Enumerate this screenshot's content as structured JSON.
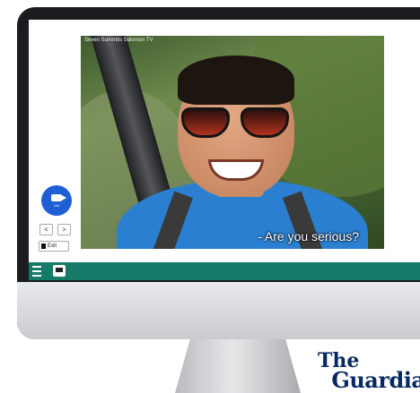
{
  "video": {
    "credit": "Seven Summits Salomon TV",
    "subtitle": "- Are you serious?"
  },
  "controls": {
    "call_label": "Vid",
    "prev_label": "<",
    "next_label": ">",
    "exit_label": "Exit"
  },
  "toolbar": {
    "color": "#157a67"
  },
  "brand": {
    "line1": "The",
    "line2": "Guardian",
    "color": "#052962"
  },
  "icons": [
    "video-camera-icon",
    "chevron-left-icon",
    "chevron-right-icon",
    "exit-icon",
    "menu-icon",
    "chat-icon"
  ]
}
